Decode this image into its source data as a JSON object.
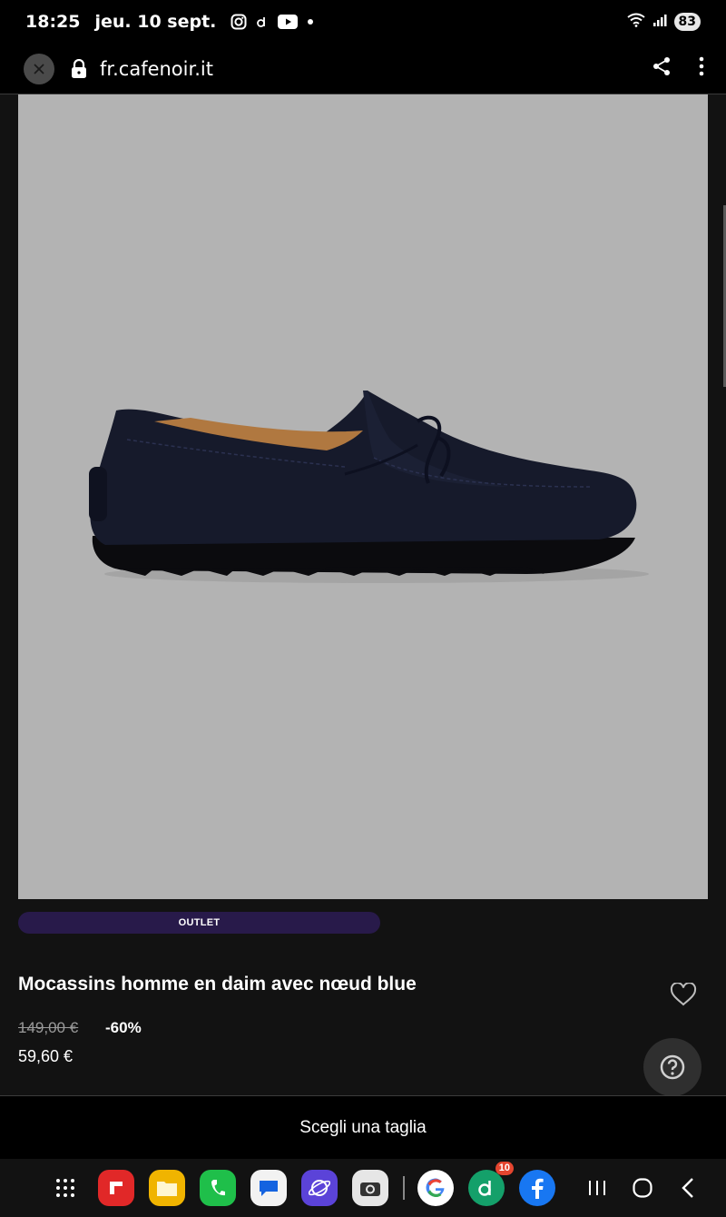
{
  "status_bar": {
    "time": "18:25",
    "date": "jeu. 10 sept.",
    "battery": "83",
    "icons": [
      "instagram-icon",
      "d-app-icon",
      "youtube-icon",
      "dot-icon",
      "wifi-icon",
      "signal-icon"
    ]
  },
  "browser": {
    "url": "fr.cafenoir.it",
    "icons": [
      "close-icon",
      "lock-icon",
      "share-icon",
      "more-vert-icon"
    ]
  },
  "product": {
    "badge": "OUTLET",
    "title": "Mocassins homme en daim avec nœud blue",
    "old_price": "149,00 €",
    "discount": "-60%",
    "price": "59,60 €",
    "image_bg": "#b3b3b3",
    "shoe_color": "#161a2b"
  },
  "cta": {
    "label": "Scegli una taglia"
  },
  "nav": {
    "apps": [
      {
        "name": "apps-grid-icon"
      },
      {
        "name": "flipboard-icon"
      },
      {
        "name": "my-files-icon"
      },
      {
        "name": "phone-icon"
      },
      {
        "name": "messages-icon"
      },
      {
        "name": "internet-icon"
      },
      {
        "name": "camera-icon"
      },
      {
        "name": "google-icon"
      },
      {
        "name": "d-app-icon",
        "badge": "10"
      },
      {
        "name": "facebook-icon"
      }
    ],
    "buttons": [
      "recents-icon",
      "home-icon",
      "back-icon"
    ]
  }
}
